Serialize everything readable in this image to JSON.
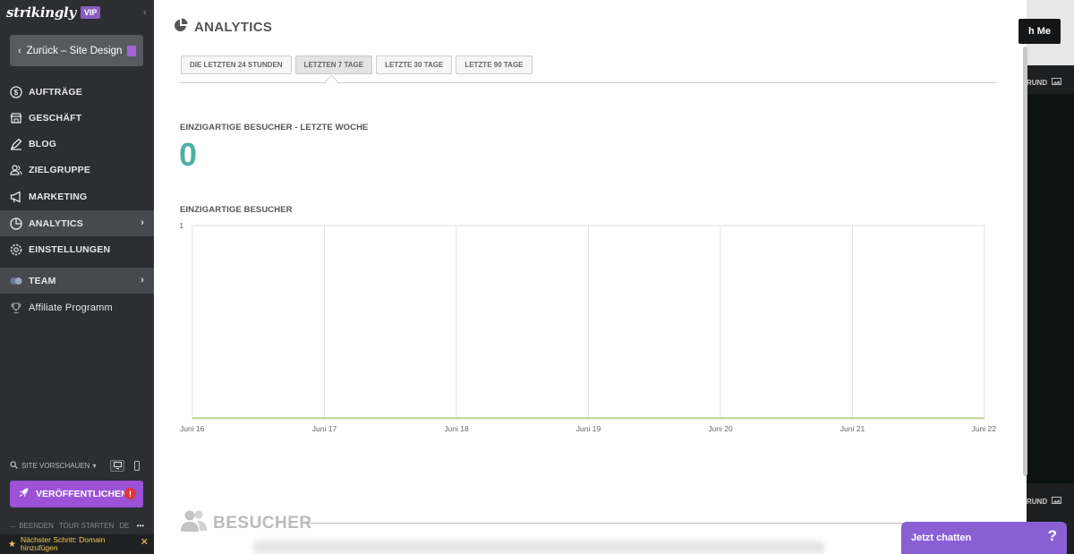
{
  "sidebar": {
    "brand": "strikingly",
    "badge": "VIP",
    "back_label": "Zurück – Site Design",
    "items": [
      {
        "label": "AUFTRÄGE"
      },
      {
        "label": "GESCHÄFT"
      },
      {
        "label": "BLOG"
      },
      {
        "label": "ZIELGRUPPE"
      },
      {
        "label": "MARKETING"
      },
      {
        "label": "ANALYTICS"
      },
      {
        "label": "EINSTELLUNGEN"
      },
      {
        "label": "TEAM"
      },
      {
        "label": "Affiliate Programm"
      }
    ],
    "preview_label": "SITE VORSCHAUEN",
    "publish_label": "VERÖFFENTLICHEN",
    "publish_warning": "!",
    "tour": {
      "end": "← BEENDEN",
      "start": "TOUR STARTEN",
      "lang": "DE",
      "more": "•••"
    },
    "next_step": "Nächster Schritt: Domain hinzufügen"
  },
  "main": {
    "title": "ANALYTICS",
    "tabs": [
      {
        "label": "DIE LETZTEN 24 STUNDEN"
      },
      {
        "label": "LETZTEN 7 TAGE"
      },
      {
        "label": "LETZTE 30 TAGE"
      },
      {
        "label": "LETZTE 90 TAGE"
      }
    ],
    "unique_week_label": "EINZIGARTIGE BESUCHER - LETZTE WOCHE",
    "unique_week_value": "0",
    "unique_chart_label": "EINZIGARTIGE BESUCHER",
    "visitors_heading": "BESUCHER"
  },
  "chart_data": {
    "type": "line",
    "title": "",
    "x": [
      "Juni 16",
      "Juni 17",
      "Juni 18",
      "Juni 19",
      "Juni 20",
      "Juni 21",
      "Juni 22"
    ],
    "series": [
      {
        "values": [
          0,
          0,
          0,
          0,
          0,
          0,
          0
        ]
      }
    ],
    "ylim": [
      0,
      1
    ],
    "yticks": [
      "1"
    ],
    "grid": true,
    "colors": {
      "line": "#b5cf86",
      "grid": "#e2e2e2"
    }
  },
  "right_panel": {
    "button_label": "h Me",
    "strip_label": "RUND"
  },
  "chat": {
    "label": "Jetzt chatten",
    "help": "?"
  },
  "colors": {
    "accent": "#9b52d6",
    "number": "#4cb2a2",
    "sidebar": "#2c2e31"
  }
}
